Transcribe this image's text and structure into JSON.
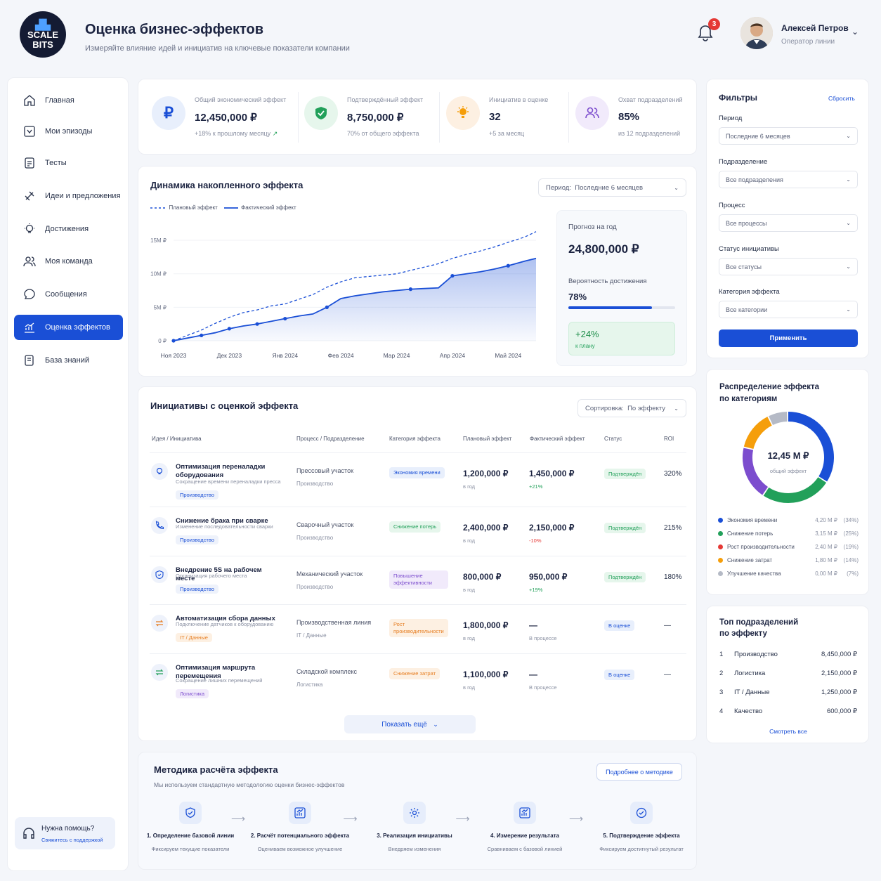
{
  "brand": {
    "logo_line1": "SCALE",
    "logo_line2": "BITS"
  },
  "header": {
    "title": "Оценка бизнес-эффектов",
    "subtitle": "Измеряйте влияние идей и инициатив на ключевые показатели компании",
    "notifications": "3",
    "user_name": "Алексей Петров",
    "user_role": "Оператор линии"
  },
  "sidebar": {
    "items": [
      {
        "label": "Главная",
        "icon": "home-icon"
      },
      {
        "label": "Мои эпизоды",
        "icon": "episodes-icon"
      },
      {
        "label": "Тесты",
        "icon": "tests-icon"
      },
      {
        "label": "Идеи и предложения",
        "icon": "ideas-icon"
      },
      {
        "label": "Достижения",
        "icon": "achievements-icon"
      },
      {
        "label": "Моя команда",
        "icon": "team-icon"
      },
      {
        "label": "Сообщения",
        "icon": "messages-icon"
      },
      {
        "label": "Оценка эффектов",
        "icon": "chart-icon",
        "active": true
      },
      {
        "label": "База знаний",
        "icon": "knowledge-icon"
      }
    ],
    "help_title": "Нужна помощь?",
    "help_link": "Свяжитесь с поддержкой"
  },
  "kpis": [
    {
      "label": "Общий экономический эффект",
      "value": "12,450,000 ₽",
      "sub": "+18% к прошлому месяцу",
      "icon": "ruble-icon",
      "color": "#1a4fd6"
    },
    {
      "label": "Подтверждённый эффект",
      "value": "8,750,000 ₽",
      "sub": "70% от общего эффекта",
      "icon": "shield-check-icon",
      "color": "#22a05a"
    },
    {
      "label": "Инициатив в оценке",
      "value": "32",
      "sub": "+5 за месяц",
      "icon": "bulb-icon",
      "color": "#f59e0b"
    },
    {
      "label": "Охват подразделений",
      "value": "85%",
      "sub": "из 12 подразделений",
      "icon": "team-icon",
      "color": "#7c4dce"
    }
  ],
  "chart_section": {
    "title": "Динамика накопленного эффекта",
    "period_label": "Период:",
    "period_value": "Последние 6 месяцев",
    "legend_plan": "Плановый эффект",
    "legend_fact": "Фактический эффект",
    "forecast_label": "Прогноз на год",
    "forecast_value": "24,800,000 ₽",
    "prob_label": "Вероятность достижения",
    "prob_value": "78%",
    "prob_fraction": 0.78,
    "delta_value": "+24%",
    "delta_label": "к плану"
  },
  "chart_data": {
    "type": "line",
    "x_labels": [
      "Ноя 2023",
      "Дек 2023",
      "Янв 2024",
      "Фев 2024",
      "Мар 2024",
      "Апр 2024",
      "Май 2024"
    ],
    "y_ticks": [
      "0 ₽",
      "5M ₽",
      "10M ₽",
      "15M ₽"
    ],
    "ylim": [
      0,
      17
    ],
    "series": [
      {
        "name": "Плановый эффект",
        "style": "dashed",
        "x": [
          0,
          0.25,
          0.5,
          0.75,
          1,
          1.25,
          1.5,
          1.75,
          2,
          2.25,
          2.5,
          2.75,
          3,
          3.25,
          3.5,
          3.75,
          4,
          4.25,
          4.5,
          4.75,
          5,
          5.25,
          5.5,
          5.75,
          6,
          6.3,
          6.5
        ],
        "y": [
          0,
          0.8,
          1.6,
          2.6,
          3.5,
          4.2,
          4.6,
          5.2,
          5.5,
          6.2,
          6.9,
          8.0,
          8.8,
          9.4,
          9.6,
          9.8,
          10.0,
          10.5,
          11.0,
          11.5,
          12.3,
          12.9,
          13.4,
          14.0,
          14.7,
          15.5,
          16.3
        ]
      },
      {
        "name": "Фактический эффект",
        "style": "solid",
        "x": [
          0,
          0.25,
          0.5,
          0.75,
          1,
          1.25,
          1.5,
          1.75,
          2,
          2.25,
          2.5,
          2.75,
          3,
          3.25,
          3.5,
          3.75,
          4,
          4.25,
          4.5,
          4.75,
          5,
          5.25,
          5.5,
          5.75,
          6,
          6.3,
          6.5
        ],
        "y": [
          0,
          0.4,
          0.8,
          1.2,
          1.8,
          2.2,
          2.5,
          2.9,
          3.3,
          3.7,
          4.0,
          5.0,
          6.3,
          6.7,
          7.0,
          7.3,
          7.5,
          7.7,
          7.8,
          7.9,
          9.7,
          10.0,
          10.3,
          10.7,
          11.2,
          11.9,
          12.3
        ]
      }
    ]
  },
  "table": {
    "title": "Инициативы с оценкой эффекта",
    "sort_label": "Сортировка:",
    "sort_value": "По эффекту",
    "headers": [
      "Идея / Инициатива",
      "Процесс / Подразделение",
      "Категория эффекта",
      "Плановый эффект",
      "Фактический эффект",
      "Статус",
      "ROI"
    ],
    "rows": [
      {
        "name": "Оптимизация переналадки оборудования",
        "desc": "Сокращение времени переналадки пресса",
        "tag": "Производство",
        "process": "Прессовый участок",
        "dept": "Производство",
        "category": "Экономия времени",
        "cat_color": "#1a4fd6",
        "cat_bg": "#e8effc",
        "plan": "1,200,000 ₽",
        "plan_sub": "в год",
        "fact": "1,450,000 ₽",
        "fact_sub": "+21%",
        "fact_sub_color": "#22a05a",
        "status": "Подтверждён",
        "status_color": "#22a05a",
        "status_bg": "#e6f6ec",
        "roi": "320%",
        "icon": "bulb-icon"
      },
      {
        "name": "Снижение брака при сварке",
        "desc": "Изменение последовательности сварки",
        "tag": "Производство",
        "process": "Сварочный участок",
        "dept": "Производство",
        "category": "Снижение потерь",
        "cat_color": "#22a05a",
        "cat_bg": "#e6f6ec",
        "plan": "2,400,000 ₽",
        "plan_sub": "в год",
        "fact": "2,150,000 ₽",
        "fact_sub": "-10%",
        "fact_sub_color": "#e53935",
        "status": "Подтверждён",
        "status_color": "#22a05a",
        "status_bg": "#e6f6ec",
        "roi": "215%",
        "icon": "phone-icon"
      },
      {
        "name": "Внедрение 5S на рабочем месте",
        "desc": "Организация рабочего места",
        "tag": "Производство",
        "process": "Механический участок",
        "dept": "Производство",
        "category": "Повышение эффективности",
        "cat_color": "#7c4dce",
        "cat_bg": "#f1eafb",
        "plan": "800,000 ₽",
        "plan_sub": "в год",
        "fact": "950,000 ₽",
        "fact_sub": "+19%",
        "fact_sub_color": "#22a05a",
        "status": "Подтверждён",
        "status_color": "#22a05a",
        "status_bg": "#e6f6ec",
        "roi": "180%",
        "icon": "shield-icon"
      },
      {
        "name": "Автоматизация сбора данных",
        "desc": "Подключение датчиков к оборудованию",
        "tag": "IT / Данные",
        "tag_color": "#e67e22",
        "tag_bg": "#fdf0e2",
        "process": "Производственная линия",
        "dept": "IT / Данные",
        "category": "Рост производительности",
        "cat_color": "#e67e22",
        "cat_bg": "#fdf0e2",
        "plan": "1,800,000 ₽",
        "plan_sub": "в год",
        "fact": "—",
        "fact_sub": "В процессе",
        "fact_sub_color": "#8a90a2",
        "status": "В оценке",
        "status_color": "#1a4fd6",
        "status_bg": "#e8effc",
        "roi": "—",
        "icon": "swap-icon"
      },
      {
        "name": "Оптимизация маршрута перемещения",
        "desc": "Сокращение лишних перемещений",
        "tag": "Логистика",
        "tag_color": "#7c4dce",
        "tag_bg": "#f1eafb",
        "process": "Складской комплекс",
        "dept": "Логистика",
        "category": "Снижение затрат",
        "cat_color": "#e67e22",
        "cat_bg": "#fdf0e2",
        "plan": "1,100,000 ₽",
        "plan_sub": "в год",
        "fact": "—",
        "fact_sub": "В процессе",
        "fact_sub_color": "#8a90a2",
        "status": "В оценке",
        "status_color": "#1a4fd6",
        "status_bg": "#e8effc",
        "roi": "—",
        "icon": "route-icon"
      }
    ],
    "show_more": "Показать ещё"
  },
  "method": {
    "title": "Методика расчёта эффекта",
    "subtitle": "Мы используем стандартную методологию оценки бизнес-эффектов",
    "link": "Подробнее о методике",
    "steps": [
      {
        "title": "1. Определение базовой линии",
        "desc": "Фиксируем текущие показатели",
        "icon": "shield-check-icon"
      },
      {
        "title": "2. Расчёт потенциального эффекта",
        "desc": "Оцениваем возможное улучшение",
        "icon": "chart-icon"
      },
      {
        "title": "3. Реализация инициативы",
        "desc": "Внедряем изменения",
        "icon": "gear-icon"
      },
      {
        "title": "4. Измерение результата",
        "desc": "Сравниваем с базовой линией",
        "icon": "chart-icon"
      },
      {
        "title": "5. Подтверждение эффекта",
        "desc": "Фиксируем достигнутый результат",
        "icon": "check-circle-icon"
      }
    ]
  },
  "filters": {
    "title": "Фильтры",
    "reset": "Сбросить",
    "fields": [
      {
        "label": "Период",
        "value": "Последние 6 месяцев"
      },
      {
        "label": "Подразделение",
        "value": "Все подразделения"
      },
      {
        "label": "Процесс",
        "value": "Все процессы"
      },
      {
        "label": "Статус инициативы",
        "value": "Все статусы"
      },
      {
        "label": "Категория эффекта",
        "value": "Все категории"
      }
    ],
    "apply": "Применить"
  },
  "distribution": {
    "title_line1": "Распределение эффекта",
    "title_line2": "по категориям",
    "center_value": "12,45 M ₽",
    "center_label": "общий эффект",
    "items": [
      {
        "name": "Экономия времени",
        "value": "4,20 M ₽",
        "pct": "(34%)",
        "share": 34,
        "color": "#1a4fd6"
      },
      {
        "name": "Снижение потерь",
        "value": "3,15 M ₽",
        "pct": "(25%)",
        "share": 25,
        "color": "#22a05a"
      },
      {
        "name": "Рост производительности",
        "value": "2,40 M ₽",
        "pct": "(19%)",
        "share": 19,
        "color": "#7c4dce",
        "legend_color": "#e53935"
      },
      {
        "name": "Снижение затрат",
        "value": "1,80 M ₽",
        "pct": "(14%)",
        "share": 14,
        "color": "#f59e0b"
      },
      {
        "name": "Улучшение качества",
        "value": "0,00 M ₽",
        "pct": "(7%)",
        "share": 7,
        "color": "#b5bac6"
      }
    ]
  },
  "top": {
    "title_line1": "Топ подразделений",
    "title_line2": "по эффекту",
    "items": [
      {
        "rank": "1",
        "name": "Производство",
        "value": "8,450,000 ₽"
      },
      {
        "rank": "2",
        "name": "Логистика",
        "value": "2,150,000 ₽"
      },
      {
        "rank": "3",
        "name": "IT / Данные",
        "value": "1,250,000 ₽"
      },
      {
        "rank": "4",
        "name": "Качество",
        "value": "600,000 ₽"
      }
    ],
    "see_all": "Смотреть все"
  }
}
